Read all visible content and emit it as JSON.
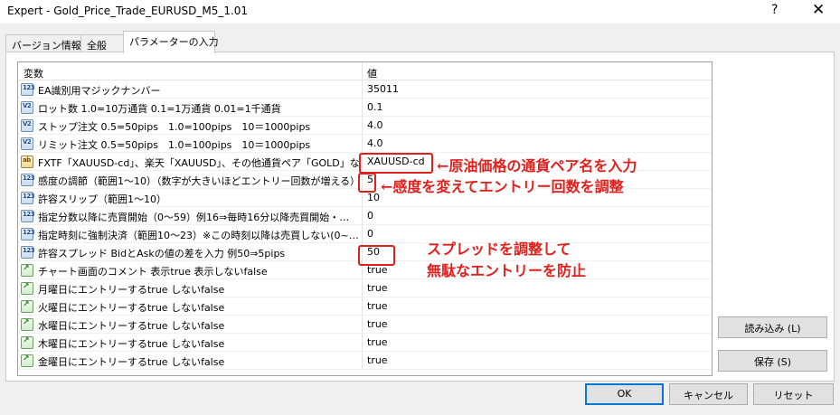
{
  "window": {
    "title": "Expert - Gold_Price_Trade_EURUSD_M5_1.01",
    "help": "?",
    "close": "✕"
  },
  "tabs": [
    {
      "label": "バージョン情報"
    },
    {
      "label": "全般"
    },
    {
      "label": "パラメーターの入力"
    }
  ],
  "grid": {
    "col_variable": "変数",
    "col_value": "値",
    "rows": [
      {
        "icon": "123",
        "name": "EA識別用マジックナンバー",
        "value": "35011"
      },
      {
        "icon": "V2",
        "name": "ロット数 1.0=10万通貨 0.1=1万通貨 0.01=1千通貨",
        "value": "0.1"
      },
      {
        "icon": "V2",
        "name": "ストップ注文 0.5=50pips　1.0=100pips　10＝1000pips",
        "value": "4.0"
      },
      {
        "icon": "V2",
        "name": "リミット注文 0.5=50pips　1.0=100pips　10＝1000pips",
        "value": "4.0"
      },
      {
        "icon": "ab",
        "name": "FXTF「XAUUSD-cd」、楽天「XAUUSD」、その他通貨ペア「GOLD」などを…",
        "value": "XAUUSD-cd"
      },
      {
        "icon": "123",
        "name": "感度の調節（範囲1～10）（数字が大きいほどエントリー回数が増える）",
        "value": "5"
      },
      {
        "icon": "123",
        "name": "許容スリップ（範囲1～10）",
        "value": "10"
      },
      {
        "icon": "123",
        "name": "指定分数以降に売買開始（0～59）例16⇒毎時16分以降売買開始・…",
        "value": "0"
      },
      {
        "icon": "123",
        "name": "指定時刻に強制決済（範囲10～23）※この時刻以降は売買しない(0~…",
        "value": "0"
      },
      {
        "icon": "123",
        "name": "許容スプレッド BidとAskの値の差を入力 例50⇒5pips",
        "value": "50"
      },
      {
        "icon": "bool",
        "name": "チャート画面のコメント 表示true 表示しないfalse",
        "value": "true"
      },
      {
        "icon": "bool",
        "name": "月曜日にエントリーするtrue しないfalse",
        "value": "true"
      },
      {
        "icon": "bool",
        "name": "火曜日にエントリーするtrue しないfalse",
        "value": "true"
      },
      {
        "icon": "bool",
        "name": "水曜日にエントリーするtrue しないfalse",
        "value": "true"
      },
      {
        "icon": "bool",
        "name": "木曜日にエントリーするtrue しないfalse",
        "value": "true"
      },
      {
        "icon": "bool",
        "name": "金曜日にエントリーするtrue しないfalse",
        "value": "true"
      }
    ]
  },
  "annotations": {
    "a1": "←原油価格の通貨ペア名を入力",
    "a2": "←感度を変えてエントリー回数を調整",
    "a3": "スプレッドを調整して",
    "a4": "無駄なエントリーを防止"
  },
  "buttons": {
    "load": "読み込み (L)",
    "save": "保存 (S)",
    "ok": "OK",
    "cancel": "キャンセル",
    "reset": "リセット"
  },
  "colors": {
    "annotation_red": "#e0201c",
    "default_button_border": "#0078d7"
  }
}
